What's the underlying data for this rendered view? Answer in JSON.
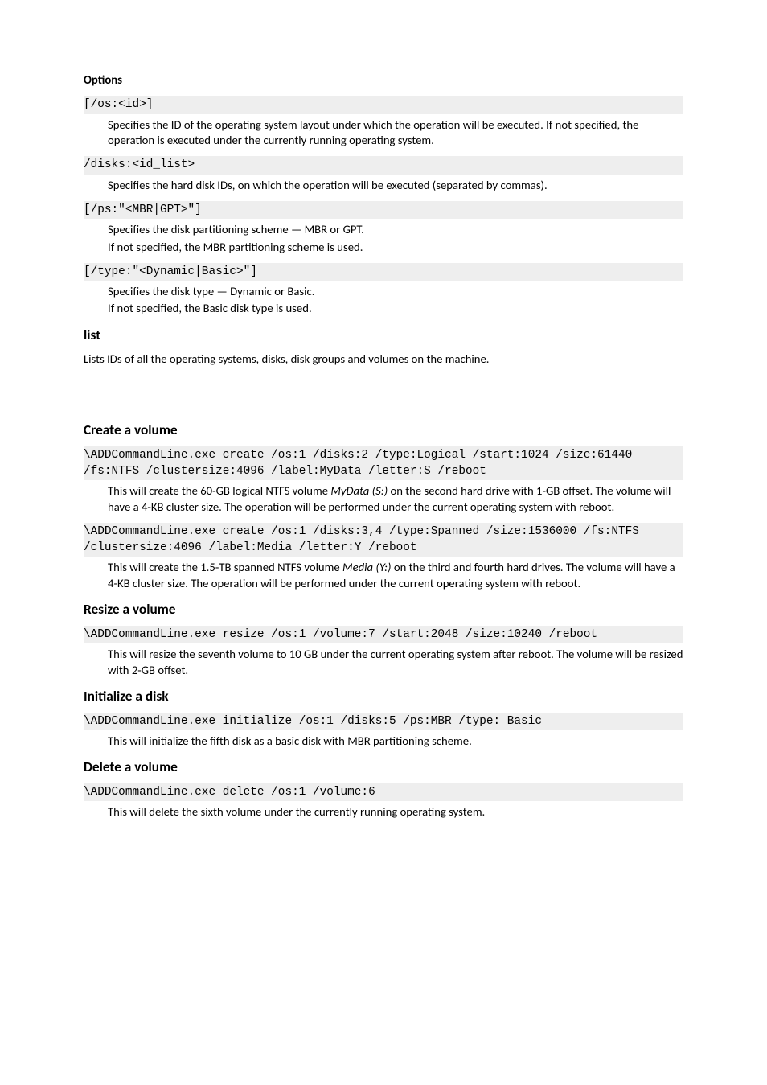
{
  "sections": {
    "options": {
      "heading": "Options",
      "items": [
        {
          "code": "[/os:<id>]",
          "desc": [
            "Specifies the ID of the operating system layout under which the operation will be executed. If not specified, the operation is executed under the currently running operating system."
          ]
        },
        {
          "code": "/disks:<id_list>",
          "desc": [
            "Specifies the hard disk IDs, on which the operation will be executed (separated by commas)."
          ]
        },
        {
          "code": "[/ps:\"<MBR|GPT>\"]",
          "desc": [
            "Specifies the disk partitioning scheme — MBR or GPT.",
            "If not specified, the MBR partitioning scheme is used."
          ]
        },
        {
          "code": "[/type:\"<Dynamic|Basic>\"]",
          "desc": [
            "Specifies the disk type — Dynamic or Basic.",
            "If not specified, the Basic disk type is used."
          ]
        }
      ]
    },
    "list": {
      "heading": "list",
      "body": "Lists IDs of all the operating systems, disks, disk groups and volumes on the machine."
    },
    "create": {
      "heading": "Create a volume",
      "items": [
        {
          "code": "\\ADDCommandLine.exe create /os:1 /disks:2 /type:Logical /start:1024 /size:61440 /fs:NTFS /clustersize:4096 /label:MyData /letter:S /reboot",
          "desc_pre": "This will create the 60-GB logical NTFS volume ",
          "desc_em": "MyData (S:)",
          "desc_post": " on the second hard drive with 1-GB offset. The volume will have a 4-KB cluster size. The operation will be performed under the current operating system with reboot."
        },
        {
          "code": "\\ADDCommandLine.exe create /os:1 /disks:3,4 /type:Spanned /size:1536000 /fs:NTFS /clustersize:4096 /label:Media /letter:Y /reboot",
          "desc_pre": "This will create the 1.5-TB spanned NTFS volume ",
          "desc_em": "Media (Y:)",
          "desc_post": " on the third and fourth hard drives. The volume will have a 4-KB cluster size. The operation will be performed under the current operating system with reboot."
        }
      ]
    },
    "resize": {
      "heading": "Resize a volume",
      "code": "\\ADDCommandLine.exe resize /os:1 /volume:7 /start:2048 /size:10240 /reboot",
      "desc": "This will resize the seventh volume to 10 GB under the current operating system after reboot. The volume will be resized with 2-GB offset."
    },
    "initialize": {
      "heading": "Initialize a disk",
      "code": "\\ADDCommandLine.exe initialize /os:1 /disks:5 /ps:MBR /type: Basic",
      "desc": "This will initialize the fifth disk as a basic disk with MBR partitioning scheme."
    },
    "delete": {
      "heading": "Delete a volume",
      "code": "\\ADDCommandLine.exe delete /os:1 /volume:6",
      "desc": "This will delete the sixth volume under the currently running operating system."
    }
  }
}
